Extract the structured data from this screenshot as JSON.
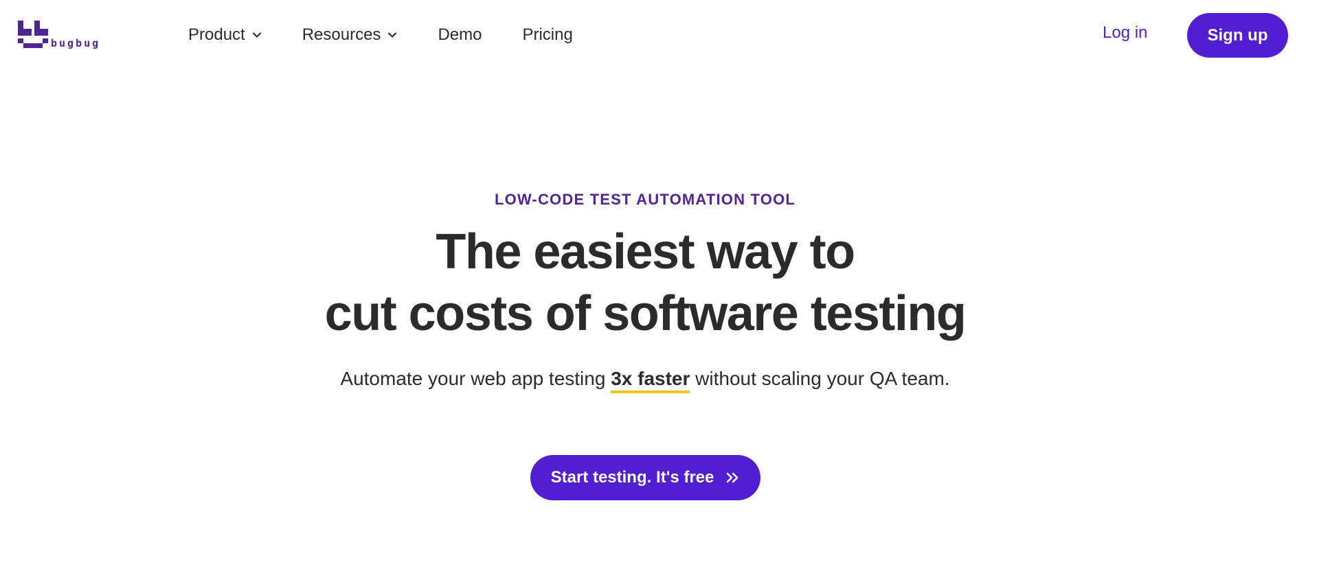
{
  "brand": {
    "name": "bugbug",
    "color": "#4d2596"
  },
  "nav": {
    "items": [
      {
        "label": "Product",
        "has_dropdown": true
      },
      {
        "label": "Resources",
        "has_dropdown": true
      },
      {
        "label": "Demo",
        "has_dropdown": false
      },
      {
        "label": "Pricing",
        "has_dropdown": false
      }
    ],
    "login_label": "Log in",
    "signup_label": "Sign up"
  },
  "hero": {
    "eyebrow": "LOW-CODE TEST AUTOMATION TOOL",
    "headline_line1": "The easiest way to",
    "headline_line2": "cut costs of software testing",
    "subline_before": "Automate your web app testing ",
    "subline_highlight": "3x faster",
    "subline_after": " without scaling your QA team.",
    "cta_label": "Start testing. It's free",
    "cta_icon": "double-chevron-right-icon"
  },
  "colors": {
    "accent": "#521ed1",
    "eyebrow": "#4d2596",
    "highlight_underline": "#f5c518",
    "text": "#2b2b2e"
  }
}
